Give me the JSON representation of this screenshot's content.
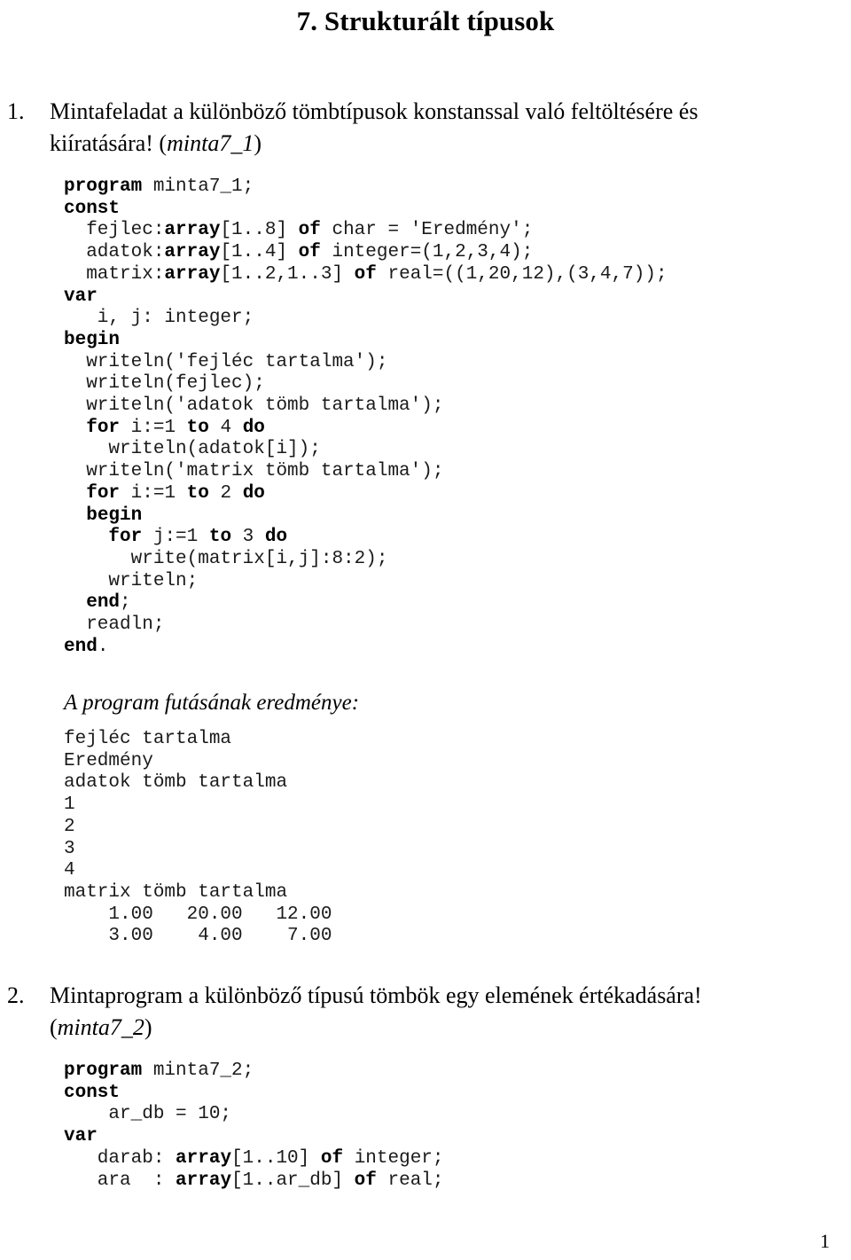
{
  "document": {
    "title": "7. Strukturált típusok",
    "page_number": "1"
  },
  "exercises": [
    {
      "marker": "1.",
      "text_line1": "Mintafeladat a különböző tömbtípusok konstanssal való feltöltésére és",
      "text_line2_prefix": "kiíratására! (",
      "text_line2_italic": "minta7_1",
      "text_line2_suffix": ")"
    },
    {
      "marker": "2.",
      "text_line1": "Mintaprogram a különböző típusú tömbök egy elemének értékadására!",
      "text_line2_prefix": "(",
      "text_line2_italic": "minta7_2",
      "text_line2_suffix": ")"
    }
  ],
  "code_blocks": {
    "minta7_1": [
      {
        "segments": [
          {
            "t": "program",
            "b": true
          },
          {
            "t": " minta7_1;",
            "b": false
          }
        ]
      },
      {
        "segments": [
          {
            "t": "const",
            "b": true
          }
        ]
      },
      {
        "segments": [
          {
            "t": "  fejlec:",
            "b": false
          },
          {
            "t": "array",
            "b": true
          },
          {
            "t": "[1..8] ",
            "b": false
          },
          {
            "t": "of",
            "b": true
          },
          {
            "t": " char = 'Eredmény';",
            "b": false
          }
        ]
      },
      {
        "segments": [
          {
            "t": "  adatok:",
            "b": false
          },
          {
            "t": "array",
            "b": true
          },
          {
            "t": "[1..4] ",
            "b": false
          },
          {
            "t": "of",
            "b": true
          },
          {
            "t": " integer=(1,2,3,4);",
            "b": false
          }
        ]
      },
      {
        "segments": [
          {
            "t": "  matrix:",
            "b": false
          },
          {
            "t": "array",
            "b": true
          },
          {
            "t": "[1..2,1..3] ",
            "b": false
          },
          {
            "t": "of",
            "b": true
          },
          {
            "t": " real=((1,20,12),(3,4,7));",
            "b": false
          }
        ]
      },
      {
        "segments": [
          {
            "t": "var",
            "b": true
          }
        ]
      },
      {
        "segments": [
          {
            "t": "   i, j: integer;",
            "b": false
          }
        ]
      },
      {
        "segments": [
          {
            "t": "",
            "b": false
          }
        ]
      },
      {
        "segments": [
          {
            "t": "begin",
            "b": true
          }
        ]
      },
      {
        "segments": [
          {
            "t": "  writeln('fejléc tartalma');",
            "b": false
          }
        ]
      },
      {
        "segments": [
          {
            "t": "  writeln(fejlec);",
            "b": false
          }
        ]
      },
      {
        "segments": [
          {
            "t": "  writeln('adatok tömb tartalma');",
            "b": false
          }
        ]
      },
      {
        "segments": [
          {
            "t": "  ",
            "b": false
          },
          {
            "t": "for",
            "b": true
          },
          {
            "t": " i:=1 ",
            "b": false
          },
          {
            "t": "to",
            "b": true
          },
          {
            "t": " 4 ",
            "b": false
          },
          {
            "t": "do",
            "b": true
          }
        ]
      },
      {
        "segments": [
          {
            "t": "    writeln(adatok[i]);",
            "b": false
          }
        ]
      },
      {
        "segments": [
          {
            "t": "  writeln('matrix tömb tartalma');",
            "b": false
          }
        ]
      },
      {
        "segments": [
          {
            "t": "  ",
            "b": false
          },
          {
            "t": "for",
            "b": true
          },
          {
            "t": " i:=1 ",
            "b": false
          },
          {
            "t": "to",
            "b": true
          },
          {
            "t": " 2 ",
            "b": false
          },
          {
            "t": "do",
            "b": true
          }
        ]
      },
      {
        "segments": [
          {
            "t": "  ",
            "b": false
          },
          {
            "t": "begin",
            "b": true
          }
        ]
      },
      {
        "segments": [
          {
            "t": "    ",
            "b": false
          },
          {
            "t": "for",
            "b": true
          },
          {
            "t": " j:=1 ",
            "b": false
          },
          {
            "t": "to",
            "b": true
          },
          {
            "t": " 3 ",
            "b": false
          },
          {
            "t": "do",
            "b": true
          }
        ]
      },
      {
        "segments": [
          {
            "t": "      write(matrix[i,j]:8:2);",
            "b": false
          }
        ]
      },
      {
        "segments": [
          {
            "t": "    writeln;",
            "b": false
          }
        ]
      },
      {
        "segments": [
          {
            "t": "  ",
            "b": false
          },
          {
            "t": "end",
            "b": true
          },
          {
            "t": ";",
            "b": false
          }
        ]
      },
      {
        "segments": [
          {
            "t": "  readln;",
            "b": false
          }
        ]
      },
      {
        "segments": [
          {
            "t": "end",
            "b": true
          },
          {
            "t": ".",
            "b": false
          }
        ]
      }
    ],
    "minta7_2": [
      {
        "segments": [
          {
            "t": "program",
            "b": true
          },
          {
            "t": " minta7_2;",
            "b": false
          }
        ]
      },
      {
        "segments": [
          {
            "t": "const",
            "b": true
          }
        ]
      },
      {
        "segments": [
          {
            "t": "    ar_db = 10;",
            "b": false
          }
        ]
      },
      {
        "segments": [
          {
            "t": "var",
            "b": true
          }
        ]
      },
      {
        "segments": [
          {
            "t": "   darab: ",
            "b": false
          },
          {
            "t": "array",
            "b": true
          },
          {
            "t": "[1..10] ",
            "b": false
          },
          {
            "t": "of",
            "b": true
          },
          {
            "t": " integer;",
            "b": false
          }
        ]
      },
      {
        "segments": [
          {
            "t": "   ara  : ",
            "b": false
          },
          {
            "t": "array",
            "b": true
          },
          {
            "t": "[1..ar_db] ",
            "b": false
          },
          {
            "t": "of",
            "b": true
          },
          {
            "t": " real;",
            "b": false
          }
        ]
      }
    ]
  },
  "result_section": {
    "caption": "A program futásának eredménye:",
    "output_lines": [
      "fejléc tartalma",
      "Eredmény",
      "adatok tömb tartalma",
      "1",
      "2",
      "3",
      "4",
      "matrix tömb tartalma",
      "    1.00   20.00   12.00",
      "    3.00    4.00    7.00"
    ]
  }
}
